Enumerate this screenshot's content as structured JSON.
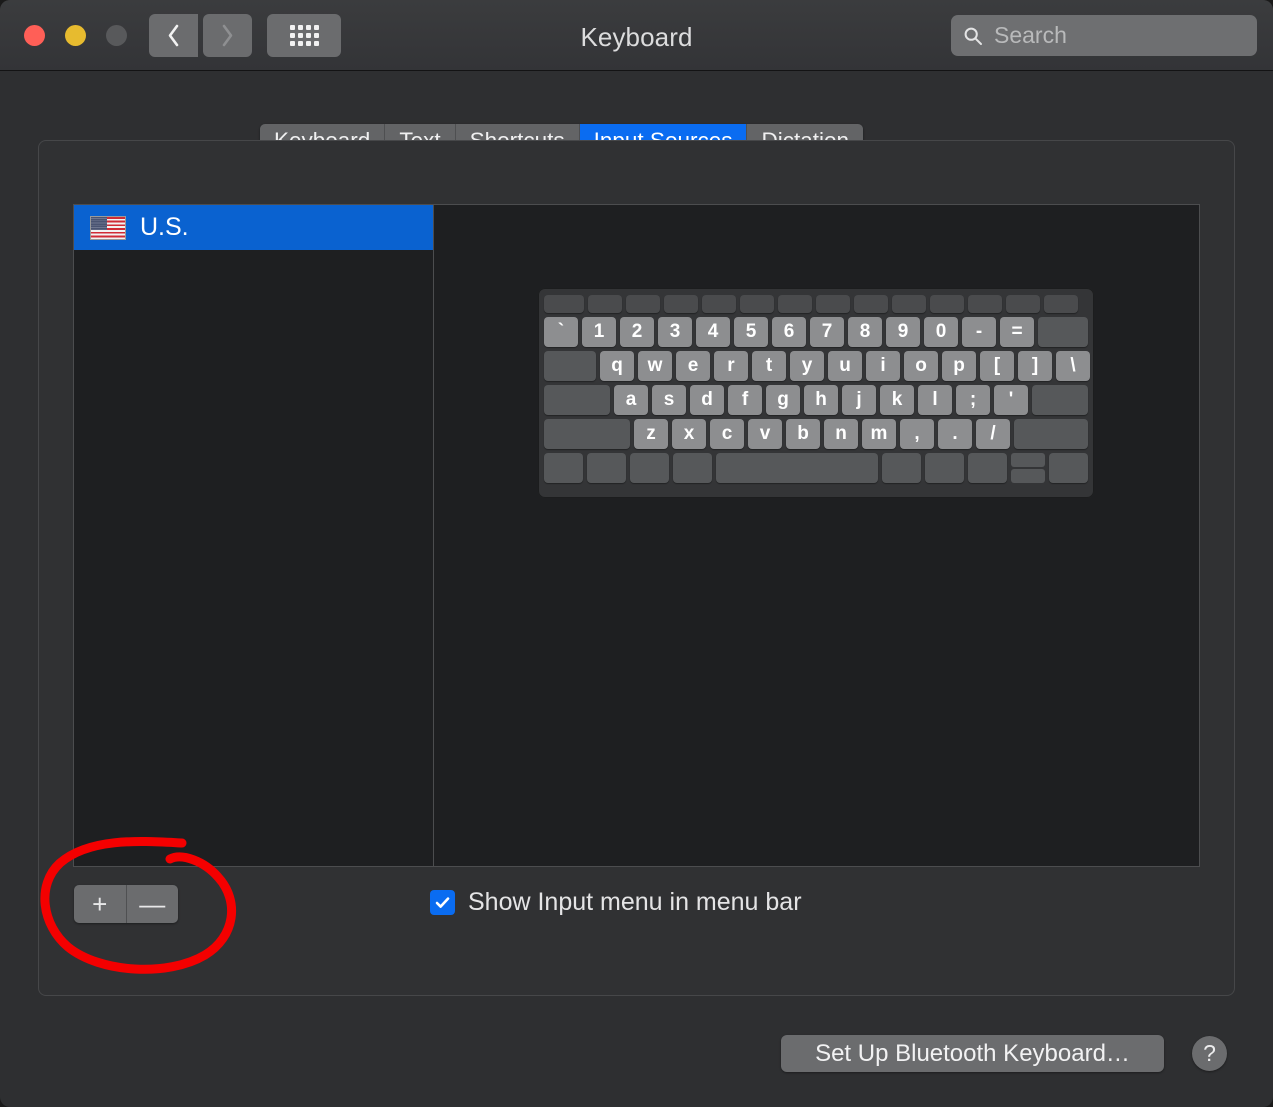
{
  "window": {
    "title": "Keyboard",
    "traffic_lights": [
      "close",
      "minimize",
      "zoom"
    ],
    "nav": {
      "back": "back-chevron",
      "forward": "forward-chevron",
      "grid": "show-all-grid"
    },
    "search": {
      "placeholder": "Search",
      "value": "",
      "icon": "search-icon"
    }
  },
  "tabs": [
    {
      "label": "Keyboard",
      "active": false
    },
    {
      "label": "Text",
      "active": false
    },
    {
      "label": "Shortcuts",
      "active": false
    },
    {
      "label": "Input Sources",
      "active": true
    },
    {
      "label": "Dictation",
      "active": false
    }
  ],
  "input_sources": {
    "items": [
      {
        "label": "U.S.",
        "icon": "us-flag-icon",
        "selected": true
      }
    ],
    "add_label": "+",
    "remove_label": "—"
  },
  "keyboard_preview": {
    "rows": [
      {
        "name": "function-row",
        "keys": [
          "",
          "",
          "",
          "",
          "",
          "",
          "",
          "",
          "",
          "",
          "",
          "",
          "",
          ""
        ],
        "style": "fn"
      },
      {
        "name": "number-row",
        "keys": [
          "`",
          "1",
          "2",
          "3",
          "4",
          "5",
          "6",
          "7",
          "8",
          "9",
          "0",
          "-",
          "="
        ],
        "trailing_dead": 1
      },
      {
        "name": "top-letter-row",
        "leading_dead": 1,
        "keys": [
          "q",
          "w",
          "e",
          "r",
          "t",
          "y",
          "u",
          "i",
          "o",
          "p",
          "[",
          "]",
          "\\"
        ]
      },
      {
        "name": "home-row",
        "leading_dead": 1,
        "keys": [
          "a",
          "s",
          "d",
          "f",
          "g",
          "h",
          "j",
          "k",
          "l",
          ";",
          "'"
        ],
        "trailing_dead": 1
      },
      {
        "name": "bottom-letter-row",
        "leading_dead": 1,
        "keys": [
          "z",
          "x",
          "c",
          "v",
          "b",
          "n",
          "m",
          ",",
          ".",
          "/"
        ],
        "trailing_dead": 1
      },
      {
        "name": "modifier-row",
        "keys": [],
        "style": "modifiers"
      }
    ]
  },
  "options": {
    "show_input_menu": {
      "label": "Show Input menu in menu bar",
      "checked": true
    }
  },
  "footer": {
    "bluetooth_button": "Set Up Bluetooth Keyboard…",
    "help_button": "?"
  },
  "annotation": {
    "color": "#f40000",
    "shape": "hand-drawn-ellipse-around-add-remove-buttons"
  }
}
